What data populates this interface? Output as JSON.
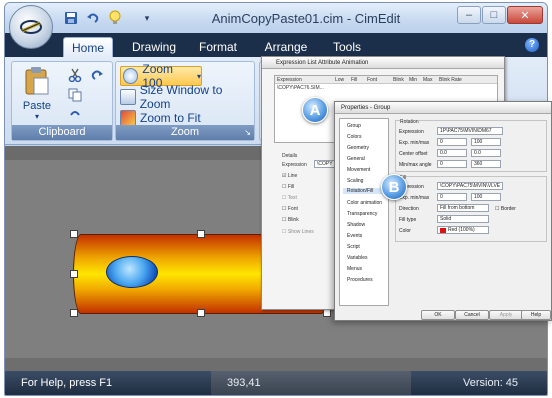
{
  "window": {
    "title": "AnimCopyPaste01.cim - CimEdit",
    "icons": [
      "office-orb-icon",
      "save-icon",
      "undo-icon",
      "lightbulb-icon",
      "qat-dropdown-icon"
    ],
    "controls": {
      "minimize": "–",
      "maximize": "□",
      "close": "✕"
    }
  },
  "tabs": [
    "Home",
    "Drawing",
    "Format",
    "Arrange",
    "Tools"
  ],
  "ribbon": {
    "clipboard": {
      "label": "Clipboard",
      "paste": "Paste",
      "icons": [
        "paste-icon",
        "cut-icon",
        "copy-icon",
        "redo-icon",
        "format-painter-icon"
      ]
    },
    "zoom": {
      "label": "Zoom",
      "zoom_value": "Zoom 100",
      "size_window": "Size Window to Zoom",
      "zoom_fit": "Zoom to Fit",
      "dialog_launcher": "↘"
    }
  },
  "dialog_a": {
    "title": "Expression List Attribute Animation",
    "columns": [
      "Expression",
      "Low",
      "Fill",
      "Font",
      "Blink",
      "Min",
      "Max",
      "Blink Rate"
    ],
    "row": "\\COPY\\PAC76.SIM...",
    "details_label": "Details",
    "expression_label": "Expression",
    "expression_value": "\\COPY",
    "checks": [
      "Line",
      "Fill",
      "Text",
      "Font",
      "Blink"
    ],
    "show_lines": "Show Lines"
  },
  "dialog_b": {
    "title": "Properties - Group",
    "nav": [
      "Group",
      "Colors",
      "Geometry",
      "General",
      "Movement",
      "Scaling",
      "Rotation/Fill",
      "Color animation",
      "Transparency",
      "Shadow",
      "Events",
      "Script",
      "Variables",
      "Menus",
      "Procedures"
    ],
    "rotation": {
      "header": "Rotation",
      "expression_label": "Expression",
      "expression": "1P\\PAC75\\MVIN\\DM67",
      "exp_minmax_label": "Exp. min/max",
      "exp_min": "0",
      "exp_max": "100",
      "center_offset_label": "Center offset",
      "center_x": "0.0",
      "center_y": "0.0",
      "min_max_angle_label": "Min/max angle",
      "angle_min": "0",
      "angle_max": "360"
    },
    "fill": {
      "header": "Fill",
      "expression_label": "Expression",
      "expression": "\\COPY\\PAC75\\MVIN\\VLVE",
      "exp_minmax_label": "Exp. min/max",
      "exp_min": "0",
      "exp_max": "100",
      "direction_label": "Direction",
      "direction": "Fill from bottom",
      "border_label": "Border",
      "fill_type_label": "Fill type",
      "fill_type": "Solid",
      "color_label": "Color",
      "color": "Red (100%)"
    },
    "buttons": [
      "OK",
      "Cancel",
      "Apply",
      "Help"
    ]
  },
  "markers": {
    "a": "A",
    "b": "B"
  },
  "status": {
    "help": "For Help, press F1",
    "coords": "393,41",
    "version": "Version: 45"
  },
  "colors": {
    "titlebar": "#c6d9f0",
    "tabbar": "#1c2f4a",
    "workspace": "#7f7f7f",
    "statusbar": "#1f2d40",
    "pipe_center": "#ffe600",
    "pipe_edge": "#c23000",
    "ellipse": "#4aa7f0"
  }
}
